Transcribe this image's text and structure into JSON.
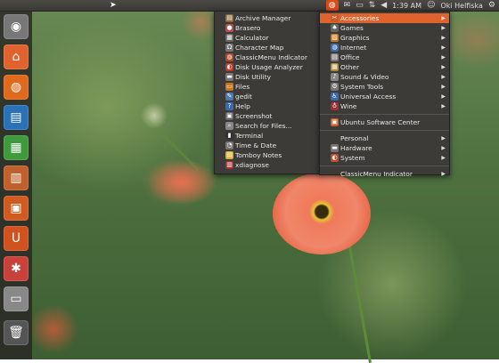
{
  "topbar": {
    "time": "1:39 AM",
    "user": "Oki Helfiska",
    "icons": [
      "classicmenu-icon",
      "mail-icon",
      "battery-icon",
      "network-icon",
      "volume-icon",
      "clock",
      "user-icon",
      "gear-icon"
    ]
  },
  "launcher": {
    "items": [
      {
        "name": "dash-home-icon",
        "glyph": "◉",
        "color": "#777"
      },
      {
        "name": "home-folder-icon",
        "glyph": "⌂",
        "color": "#e0622c"
      },
      {
        "name": "firefox-icon",
        "glyph": "◍",
        "color": "#e06a1c"
      },
      {
        "name": "libreoffice-writer-icon",
        "glyph": "▤",
        "color": "#2a72b8"
      },
      {
        "name": "libreoffice-calc-icon",
        "glyph": "▦",
        "color": "#3e9a3a"
      },
      {
        "name": "libreoffice-impress-icon",
        "glyph": "▥",
        "color": "#c0602a"
      },
      {
        "name": "software-center-icon",
        "glyph": "▣",
        "color": "#d05a20"
      },
      {
        "name": "ubuntu-one-icon",
        "glyph": "U",
        "color": "#d0521e"
      },
      {
        "name": "system-settings-icon",
        "glyph": "✱",
        "color": "#c8413a"
      },
      {
        "name": "workspace-switcher-icon",
        "glyph": "▭",
        "color": "#888"
      },
      {
        "name": "trash-icon",
        "glyph": "🗑",
        "color": "#555"
      }
    ]
  },
  "accessories_menu": {
    "items": [
      {
        "label": "Archive Manager",
        "icon": "archive-icon",
        "color": "#8a6a3a",
        "glyph": "▤"
      },
      {
        "label": "Brasero",
        "icon": "disc-icon",
        "color": "#c04a4a",
        "glyph": "●"
      },
      {
        "label": "Calculator",
        "icon": "calculator-icon",
        "color": "#666",
        "glyph": "▦"
      },
      {
        "label": "Character Map",
        "icon": "character-map-icon",
        "color": "#777",
        "glyph": "Ω"
      },
      {
        "label": "ClassicMenu Indicator",
        "icon": "classicmenu-icon",
        "color": "#b04a2a",
        "glyph": "◍"
      },
      {
        "label": "Disk Usage Analyzer",
        "icon": "disk-usage-icon",
        "color": "#c03a2a",
        "glyph": "◐"
      },
      {
        "label": "Disk Utility",
        "icon": "disk-utility-icon",
        "color": "#777",
        "glyph": "▬"
      },
      {
        "label": "Files",
        "icon": "files-icon",
        "color": "#c8761e",
        "glyph": "▭"
      },
      {
        "label": "gedit",
        "icon": "gedit-icon",
        "color": "#4a7ab0",
        "glyph": "✎"
      },
      {
        "label": "Help",
        "icon": "help-icon",
        "color": "#3a6ab0",
        "glyph": "?"
      },
      {
        "label": "Screenshot",
        "icon": "screenshot-icon",
        "color": "#666",
        "glyph": "▣"
      },
      {
        "label": "Search for Files...",
        "icon": "search-icon",
        "color": "#888",
        "glyph": "⌕"
      },
      {
        "label": "Terminal",
        "icon": "terminal-icon",
        "color": "#333",
        "glyph": "▮"
      },
      {
        "label": "Time & Date",
        "icon": "clock-icon",
        "color": "#777",
        "glyph": "◔"
      },
      {
        "label": "Tomboy Notes",
        "icon": "notes-icon",
        "color": "#d8b030",
        "glyph": "▤"
      },
      {
        "label": "xdiagnose",
        "icon": "xdiagnose-icon",
        "color": "#a03030",
        "glyph": "▥"
      }
    ]
  },
  "main_menu": {
    "groups": [
      [
        {
          "label": "Accessories",
          "icon": "accessories-icon",
          "color": "#c85a2a",
          "glyph": "✂",
          "arrow": true,
          "selected": true
        },
        {
          "label": "Games",
          "icon": "games-icon",
          "color": "#666",
          "glyph": "♠",
          "arrow": true
        },
        {
          "label": "Graphics",
          "icon": "graphics-icon",
          "color": "#c8761e",
          "glyph": "▧",
          "arrow": true
        },
        {
          "label": "Internet",
          "icon": "internet-icon",
          "color": "#3a6ab0",
          "glyph": "◍",
          "arrow": true
        },
        {
          "label": "Office",
          "icon": "office-icon",
          "color": "#7a7a7a",
          "glyph": "▤",
          "arrow": true
        },
        {
          "label": "Other",
          "icon": "other-icon",
          "color": "#b08a3a",
          "glyph": "▦",
          "arrow": true
        },
        {
          "label": "Sound & Video",
          "icon": "sound-video-icon",
          "color": "#888",
          "glyph": "♪",
          "arrow": true
        },
        {
          "label": "System Tools",
          "icon": "system-tools-icon",
          "color": "#777",
          "glyph": "⚙",
          "arrow": true
        },
        {
          "label": "Universal Access",
          "icon": "universal-access-icon",
          "color": "#3a6ab0",
          "glyph": "♿",
          "arrow": true
        },
        {
          "label": "Wine",
          "icon": "wine-icon",
          "color": "#a03030",
          "glyph": "♁",
          "arrow": true
        }
      ],
      [
        {
          "label": "Ubuntu Software Center",
          "icon": "software-center-icon",
          "color": "#d05a20",
          "glyph": "▣",
          "arrow": false
        }
      ],
      [
        {
          "label": "Personal",
          "icon": "",
          "color": "",
          "glyph": "",
          "arrow": true
        },
        {
          "label": "Hardware",
          "icon": "hardware-icon",
          "color": "#777",
          "glyph": "▬",
          "arrow": true
        },
        {
          "label": "System",
          "icon": "system-icon",
          "color": "#c04a2a",
          "glyph": "◐",
          "arrow": true
        }
      ],
      [
        {
          "label": "ClassicMenu Indicator",
          "icon": "",
          "color": "",
          "glyph": "",
          "arrow": true
        }
      ]
    ]
  }
}
